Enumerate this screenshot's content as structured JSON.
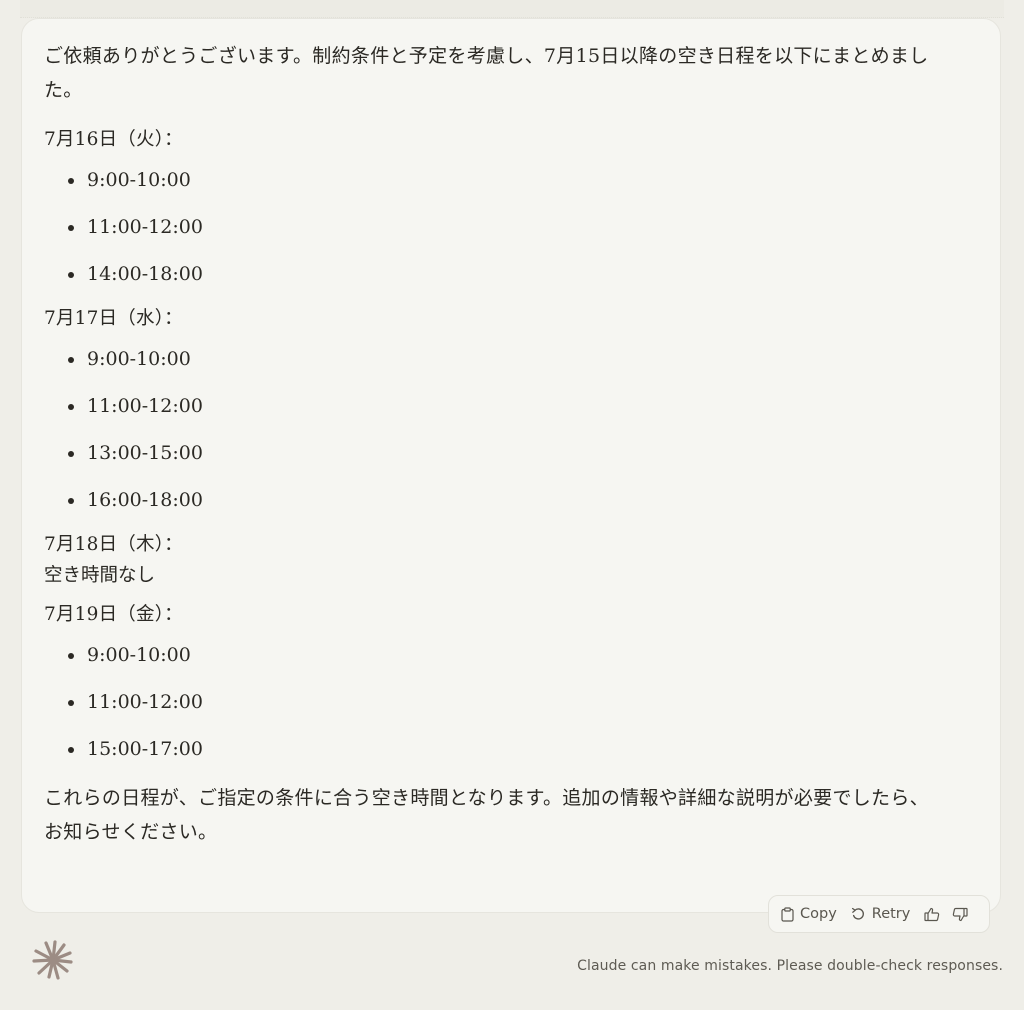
{
  "message": {
    "intro": "ご依頼ありがとうございます。制約条件と予定を考慮し、7月15日以降の空き日程を以下にまとめました。",
    "days": [
      {
        "heading": "7月16日（火）：",
        "slots": [
          "9:00-10:00",
          "11:00-12:00",
          "14:00-18:00"
        ]
      },
      {
        "heading": "7月17日（水）：",
        "slots": [
          "9:00-10:00",
          "11:00-12:00",
          "13:00-15:00",
          "16:00-18:00"
        ]
      },
      {
        "heading": "7月18日（木）：",
        "none_text": "空き時間なし"
      },
      {
        "heading": "7月19日（金）：",
        "slots": [
          "9:00-10:00",
          "11:00-12:00",
          "15:00-17:00"
        ]
      }
    ],
    "outro": "これらの日程が、ご指定の条件に合う空き時間となります。追加の情報や詳細な説明が必要でしたら、お知らせください。"
  },
  "actions": {
    "copy_label": "Copy",
    "retry_label": "Retry",
    "copy_icon": "clipboard-icon",
    "retry_icon": "retry-icon",
    "thumbs_up_icon": "thumbs-up-icon",
    "thumbs_down_icon": "thumbs-down-icon"
  },
  "footer": {
    "logo_icon": "claude-starburst-icon",
    "disclaimer": "Claude can make mistakes. Please double-check responses."
  },
  "colors": {
    "page_bg": "#efeee8",
    "card_bg": "#f6f6f2",
    "text": "#2b2924",
    "muted_text": "#5e5b53",
    "logo": "#9c8c84"
  }
}
